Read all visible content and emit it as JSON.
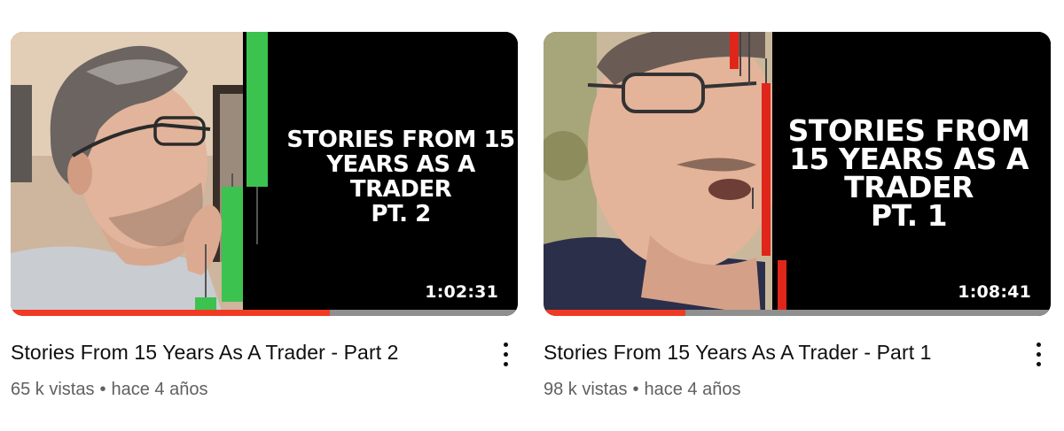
{
  "videos": [
    {
      "thumbnail_text": "STORIES FROM 15\nYEARS AS A\nTRADER\nPT. 2",
      "duration": "1:02:31",
      "watch_progress": 0.63,
      "title": "Stories From 15 Years As A Trader - Part 2",
      "views": "65 k vistas",
      "separator": "•",
      "age": "hace 4 años",
      "more_icon": "more-vert-icon"
    },
    {
      "thumbnail_text": "STORIES FROM\n15 YEARS AS A\nTRADER\nPT. 1",
      "duration": "1:08:41",
      "watch_progress": 0.28,
      "title": "Stories From 15 Years As A Trader - Part 1",
      "views": "98 k vistas",
      "separator": "•",
      "age": "hace 4 años",
      "more_icon": "more-vert-icon"
    }
  ],
  "colors": {
    "progress": "#f03a23",
    "progress_track": "#8f8f8f",
    "candle_green": "#3cc24f",
    "candle_red": "#e0261b",
    "meta_text": "#606060"
  }
}
